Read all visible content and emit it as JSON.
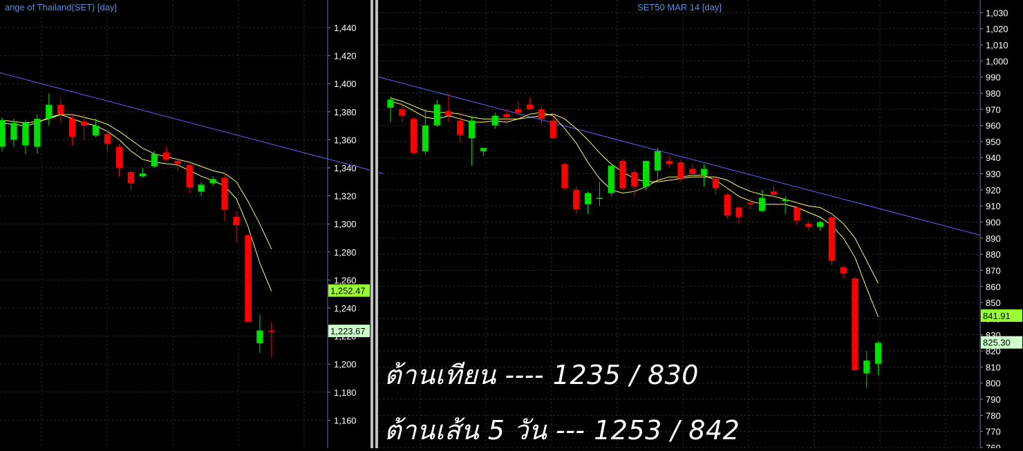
{
  "colors": {
    "background": "#000000",
    "grid": "#2a2a2a",
    "axis_text": "#ffffff",
    "up_candle": "#00e000",
    "down_candle": "#ff0000",
    "ma_fast": "#ffff66",
    "ma_slow": "#ffff66",
    "trendline": "#6060ff",
    "title": "#5a8fd8",
    "divider": "#c0c0c0"
  },
  "chart_data": [
    {
      "type": "candlestick",
      "title": "ange of Thailand(SET)  [day]",
      "ylim": [
        1140,
        1460
      ],
      "y_ticks": [
        "1,160",
        "1,180",
        "1,200",
        "1,220",
        "1,240",
        "1,260",
        "1,280",
        "1,300",
        "1,320",
        "1,340",
        "1,360",
        "1,380",
        "1,400",
        "1,420",
        "1,440"
      ],
      "y_tick_values": [
        1160,
        1180,
        1200,
        1220,
        1240,
        1260,
        1280,
        1300,
        1320,
        1340,
        1360,
        1380,
        1400,
        1420,
        1440
      ],
      "last_price_labels": [
        {
          "text": "1,252.47",
          "value": 1252.47,
          "color": "#99ff33",
          "text_color": "#000000"
        },
        {
          "text": "1,223.67",
          "value": 1223.67,
          "color": "#ccffcc",
          "text_color": "#000000"
        }
      ],
      "candles": [
        {
          "o": 1355,
          "h": 1376,
          "l": 1352,
          "c": 1374
        },
        {
          "o": 1360,
          "h": 1375,
          "l": 1355,
          "c": 1372
        },
        {
          "o": 1356,
          "h": 1374,
          "l": 1350,
          "c": 1372
        },
        {
          "o": 1355,
          "h": 1378,
          "l": 1350,
          "c": 1375
        },
        {
          "o": 1375,
          "h": 1393,
          "l": 1370,
          "c": 1385
        },
        {
          "o": 1385,
          "h": 1390,
          "l": 1372,
          "c": 1378
        },
        {
          "o": 1375,
          "h": 1378,
          "l": 1356,
          "c": 1362
        },
        {
          "o": 1373,
          "h": 1378,
          "l": 1360,
          "c": 1370
        },
        {
          "o": 1363,
          "h": 1375,
          "l": 1362,
          "c": 1370
        },
        {
          "o": 1364,
          "h": 1366,
          "l": 1352,
          "c": 1357
        },
        {
          "o": 1355,
          "h": 1357,
          "l": 1334,
          "c": 1340
        },
        {
          "o": 1337,
          "h": 1338,
          "l": 1324,
          "c": 1329
        },
        {
          "o": 1334,
          "h": 1340,
          "l": 1333,
          "c": 1336
        },
        {
          "o": 1341,
          "h": 1352,
          "l": 1340,
          "c": 1350
        },
        {
          "o": 1351,
          "h": 1355,
          "l": 1345,
          "c": 1346
        },
        {
          "o": 1345,
          "h": 1347,
          "l": 1338,
          "c": 1343
        },
        {
          "o": 1342,
          "h": 1344,
          "l": 1322,
          "c": 1326
        },
        {
          "o": 1323,
          "h": 1330,
          "l": 1320,
          "c": 1328
        },
        {
          "o": 1329,
          "h": 1334,
          "l": 1327,
          "c": 1332
        },
        {
          "o": 1333,
          "h": 1336,
          "l": 1302,
          "c": 1310
        },
        {
          "o": 1305,
          "h": 1309,
          "l": 1287,
          "c": 1299
        },
        {
          "o": 1292,
          "h": 1293,
          "l": 1230,
          "c": 1230
        },
        {
          "o": 1215,
          "h": 1235,
          "l": 1208,
          "c": 1224
        },
        {
          "o": 1224,
          "h": 1230,
          "l": 1205,
          "c": 1223
        }
      ],
      "ma_fast": [
        1372,
        1371,
        1370,
        1372,
        1376,
        1378,
        1375,
        1372,
        1370,
        1366,
        1360,
        1352,
        1346,
        1344,
        1343,
        1342,
        1338,
        1334,
        1331,
        1327,
        1318,
        1298,
        1272,
        1252
      ],
      "ma_slow": [
        1374,
        1373,
        1372,
        1373,
        1375,
        1378,
        1378,
        1376,
        1374,
        1371,
        1366,
        1360,
        1354,
        1350,
        1348,
        1346,
        1344,
        1341,
        1338,
        1336,
        1330,
        1316,
        1300,
        1282
      ],
      "trendline": [
        {
          "i": -3,
          "v": 1414
        },
        {
          "i": 32.5,
          "v": 1336
        }
      ]
    },
    {
      "type": "candlestick",
      "title": "SET50 MAR 14   [day]",
      "ylim": [
        760,
        1037
      ],
      "y_ticks": [
        "760",
        "770",
        "780",
        "790",
        "800",
        "810",
        "820",
        "830",
        "840",
        "850",
        "860",
        "870",
        "880",
        "890",
        "900",
        "910",
        "920",
        "930",
        "940",
        "950",
        "960",
        "970",
        "980",
        "990",
        "1,000",
        "1,010",
        "1,020",
        "1,030"
      ],
      "y_tick_values": [
        760,
        770,
        780,
        790,
        800,
        810,
        820,
        830,
        840,
        850,
        860,
        870,
        880,
        890,
        900,
        910,
        920,
        930,
        940,
        950,
        960,
        970,
        980,
        990,
        1000,
        1010,
        1020,
        1030
      ],
      "last_price_labels": [
        {
          "text": "841.91",
          "value": 841.91,
          "color": "#99ff33",
          "text_color": "#000000"
        },
        {
          "text": "825.30",
          "value": 825.3,
          "color": "#ccffcc",
          "text_color": "#000000"
        }
      ],
      "candles": [
        {
          "o": 971,
          "h": 978,
          "l": 962,
          "c": 976
        },
        {
          "o": 970,
          "h": 973,
          "l": 962,
          "c": 966
        },
        {
          "o": 964,
          "h": 965,
          "l": 942,
          "c": 943
        },
        {
          "o": 944,
          "h": 970,
          "l": 942,
          "c": 960
        },
        {
          "o": 960,
          "h": 976,
          "l": 959,
          "c": 973
        },
        {
          "o": 969,
          "h": 980,
          "l": 962,
          "c": 966
        },
        {
          "o": 963,
          "h": 968,
          "l": 949,
          "c": 954
        },
        {
          "o": 952,
          "h": 966,
          "l": 935,
          "c": 963
        },
        {
          "o": 944,
          "h": 946,
          "l": 941,
          "c": 946
        },
        {
          "o": 960,
          "h": 968,
          "l": 958,
          "c": 966
        },
        {
          "o": 967,
          "h": 970,
          "l": 962,
          "c": 965
        },
        {
          "o": 970,
          "h": 975,
          "l": 966,
          "c": 968
        },
        {
          "o": 973,
          "h": 977,
          "l": 970,
          "c": 970
        },
        {
          "o": 970,
          "h": 972,
          "l": 961,
          "c": 964
        },
        {
          "o": 963,
          "h": 966,
          "l": 956,
          "c": 952
        },
        {
          "o": 936,
          "h": 937,
          "l": 920,
          "c": 921
        },
        {
          "o": 920,
          "h": 922,
          "l": 905,
          "c": 908
        },
        {
          "o": 911,
          "h": 919,
          "l": 905,
          "c": 918
        },
        {
          "o": 915,
          "h": 925,
          "l": 910,
          "c": 915
        },
        {
          "o": 918,
          "h": 935,
          "l": 916,
          "c": 935
        },
        {
          "o": 938,
          "h": 939,
          "l": 920,
          "c": 921
        },
        {
          "o": 931,
          "h": 933,
          "l": 916,
          "c": 922
        },
        {
          "o": 922,
          "h": 938,
          "l": 920,
          "c": 938
        },
        {
          "o": 932,
          "h": 946,
          "l": 927,
          "c": 944
        },
        {
          "o": 938,
          "h": 941,
          "l": 934,
          "c": 936
        },
        {
          "o": 937,
          "h": 939,
          "l": 925,
          "c": 927
        },
        {
          "o": 933,
          "h": 936,
          "l": 928,
          "c": 930
        },
        {
          "o": 929,
          "h": 936,
          "l": 922,
          "c": 933
        },
        {
          "o": 927,
          "h": 928,
          "l": 917,
          "c": 921
        },
        {
          "o": 917,
          "h": 918,
          "l": 902,
          "c": 904
        },
        {
          "o": 909,
          "h": 910,
          "l": 899,
          "c": 903
        },
        {
          "o": 912,
          "h": 915,
          "l": 908,
          "c": 911
        },
        {
          "o": 907,
          "h": 920,
          "l": 906,
          "c": 915
        },
        {
          "o": 919,
          "h": 922,
          "l": 915,
          "c": 917
        },
        {
          "o": 913,
          "h": 916,
          "l": 905,
          "c": 914
        },
        {
          "o": 909,
          "h": 910,
          "l": 898,
          "c": 901
        },
        {
          "o": 899,
          "h": 901,
          "l": 895,
          "c": 897
        },
        {
          "o": 897,
          "h": 901,
          "l": 895,
          "c": 900
        },
        {
          "o": 903,
          "h": 904,
          "l": 873,
          "c": 876
        },
        {
          "o": 872,
          "h": 873,
          "l": 865,
          "c": 868
        },
        {
          "o": 865,
          "h": 866,
          "l": 808,
          "c": 808
        },
        {
          "o": 806,
          "h": 820,
          "l": 797,
          "c": 814
        },
        {
          "o": 812,
          "h": 826,
          "l": 805,
          "c": 825
        }
      ],
      "ma_fast": [
        975,
        973,
        969,
        965,
        964,
        966,
        964,
        962,
        962,
        963,
        962,
        964,
        967,
        968,
        966,
        958,
        949,
        937,
        927,
        920,
        918,
        919,
        922,
        926,
        928,
        928,
        929,
        929,
        926,
        921,
        916,
        913,
        911,
        911,
        911,
        909,
        906,
        903,
        898,
        890,
        878,
        859,
        841
      ],
      "ma_slow": [
        977,
        975,
        972,
        969,
        968,
        968,
        967,
        965,
        964,
        964,
        964,
        964,
        965,
        966,
        967,
        964,
        958,
        951,
        943,
        936,
        931,
        927,
        925,
        925,
        926,
        927,
        928,
        928,
        928,
        926,
        922,
        919,
        917,
        916,
        914,
        912,
        910,
        909,
        905,
        899,
        890,
        876,
        862
      ],
      "trendline": [
        {
          "i": -1,
          "v": 990
        },
        {
          "i": 50.8,
          "v": 891.8
        }
      ]
    }
  ],
  "annotations": [
    {
      "text": "ต้านเทียน ---- 1235 / 830"
    },
    {
      "text": "ต้านเส้น 5 วัน --- 1253 / 842"
    }
  ]
}
